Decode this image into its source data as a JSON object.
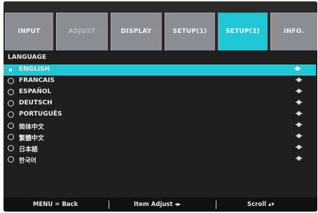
{
  "tabs": [
    {
      "label": "INPUT",
      "active": false
    },
    {
      "label": "ADJUST",
      "active": false
    },
    {
      "label": "DISPLAY",
      "active": false
    },
    {
      "label": "SETUP(1)",
      "active": false
    },
    {
      "label": "SETUP(2)",
      "active": true
    },
    {
      "label": "INFO.",
      "active": false
    }
  ],
  "section": {
    "title": "LANGUAGE"
  },
  "languages": [
    {
      "label": "ENGLISH",
      "selected": true,
      "control": "◂▮▸"
    },
    {
      "label": "FRANCAIS",
      "selected": false,
      "control": "◂▮▸"
    },
    {
      "label": "ESPAÑOL",
      "selected": false,
      "control": "◂▮▸"
    },
    {
      "label": "DEUTSCH",
      "selected": false,
      "control": "◂▮▸"
    },
    {
      "label": "PORTUGUÊS",
      "selected": false,
      "control": "◂▮▸"
    },
    {
      "label": "简体中文",
      "selected": false,
      "control": "◂▮▸"
    },
    {
      "label": "繁體中文",
      "selected": false,
      "control": "◂▮▸"
    },
    {
      "label": "日本語",
      "selected": false,
      "control": "◂▮▸"
    },
    {
      "label": "한국어",
      "selected": false,
      "control": "◂▮▸"
    }
  ],
  "footer": {
    "menu_back": "MENU  =  Back",
    "item_adjust": "Item  Adjust  ◂▸",
    "scroll": "Scroll   ▴▾"
  },
  "colors": {
    "accent": "#20c6d3",
    "tab": "#8c8e94",
    "background": "#1e1e1e"
  }
}
